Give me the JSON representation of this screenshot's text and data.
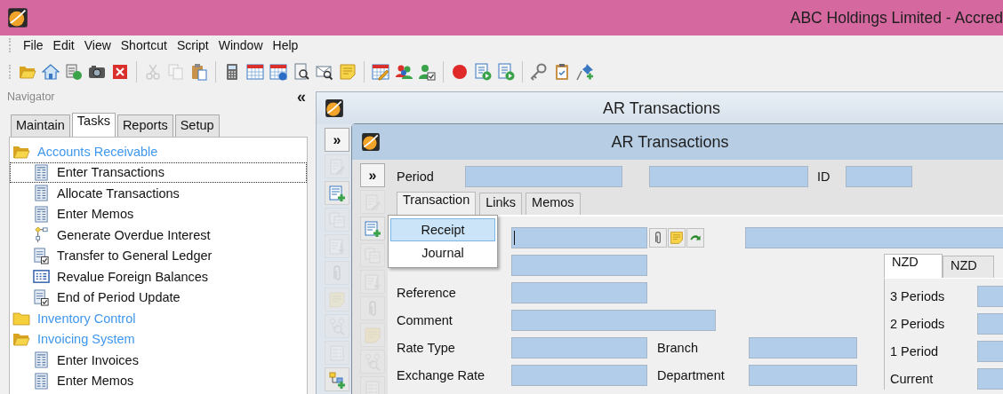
{
  "window": {
    "title": "ABC Holdings Limited - Accred"
  },
  "menu_bar": [
    "File",
    "Edit",
    "View",
    "Shortcut",
    "Script",
    "Window",
    "Help"
  ],
  "toolbar": [
    {
      "kind": "folder-open",
      "disabled": false
    },
    {
      "kind": "home",
      "disabled": false
    },
    {
      "kind": "db-refresh",
      "disabled": false
    },
    {
      "kind": "camera",
      "disabled": false
    },
    {
      "kind": "close",
      "disabled": false
    },
    {
      "kind": "separator"
    },
    {
      "kind": "scissors",
      "disabled": true
    },
    {
      "kind": "copy",
      "disabled": true
    },
    {
      "kind": "paste",
      "disabled": false
    },
    {
      "kind": "separator"
    },
    {
      "kind": "calculator",
      "disabled": false
    },
    {
      "kind": "calendar",
      "disabled": false
    },
    {
      "kind": "calendar-info",
      "disabled": false
    },
    {
      "kind": "scroll-search",
      "disabled": false
    },
    {
      "kind": "mail-search",
      "disabled": false
    },
    {
      "kind": "note",
      "disabled": false
    },
    {
      "kind": "separator"
    },
    {
      "kind": "calendar-edit",
      "disabled": false
    },
    {
      "kind": "users",
      "disabled": false
    },
    {
      "kind": "user-check",
      "disabled": false
    },
    {
      "kind": "separator"
    },
    {
      "kind": "record",
      "disabled": false
    },
    {
      "kind": "script-play",
      "disabled": false
    },
    {
      "kind": "doc-play",
      "disabled": false
    },
    {
      "kind": "separator"
    },
    {
      "kind": "key",
      "disabled": false
    },
    {
      "kind": "clipboard",
      "disabled": false
    },
    {
      "kind": "pin-add",
      "disabled": false
    }
  ],
  "navigator": {
    "title": "Navigator",
    "collapse": "«",
    "tabs": [
      {
        "label": "Maintain",
        "selected": false
      },
      {
        "label": "Tasks",
        "selected": true
      },
      {
        "label": "Reports",
        "selected": false
      },
      {
        "label": "Setup",
        "selected": false
      }
    ],
    "tree": [
      {
        "label": "Accounts Receivable",
        "kind": "folder",
        "expanded": true,
        "children": [
          {
            "label": "Enter Transactions",
            "kind": "grid-doc",
            "focused": true
          },
          {
            "label": "Allocate Transactions",
            "kind": "grid-doc",
            "focused": false
          },
          {
            "label": "Enter Memos",
            "kind": "grid-doc",
            "focused": false
          },
          {
            "label": "Generate Overdue Interest",
            "kind": "flow",
            "focused": false
          },
          {
            "label": "Transfer to General Ledger",
            "kind": "doc-check",
            "focused": false
          },
          {
            "label": "Revalue Foreign Balances",
            "kind": "table",
            "focused": false
          },
          {
            "label": "End of Period Update",
            "kind": "doc-check",
            "focused": false
          }
        ]
      },
      {
        "label": "Inventory Control",
        "kind": "folder",
        "expanded": false
      },
      {
        "label": "Invoicing System",
        "kind": "folder",
        "expanded": true,
        "children": [
          {
            "label": "Enter Invoices",
            "kind": "grid-doc",
            "focused": false
          },
          {
            "label": "Enter Memos",
            "kind": "grid-doc",
            "focused": false
          }
        ]
      }
    ]
  },
  "outer_window": {
    "title": "AR Transactions",
    "expand_button": "»",
    "side_toolbar": [
      {
        "kind": "edit-doc",
        "disabled": true
      },
      {
        "kind": "add-doc",
        "disabled": false
      },
      {
        "kind": "copy-doc",
        "disabled": true
      },
      {
        "kind": "import-doc",
        "disabled": true
      },
      {
        "kind": "paperclip",
        "disabled": true
      },
      {
        "kind": "note",
        "disabled": true
      },
      {
        "kind": "search-tree",
        "disabled": true
      },
      {
        "kind": "list",
        "disabled": true
      },
      {
        "kind": "tree-add",
        "disabled": false
      }
    ]
  },
  "inner_window": {
    "title": "AR Transactions",
    "expand_button": "»",
    "side_toolbar": [
      {
        "kind": "edit-doc",
        "disabled": true
      },
      {
        "kind": "add-doc",
        "disabled": false
      },
      {
        "kind": "copy-doc",
        "disabled": true
      },
      {
        "kind": "import-doc",
        "disabled": true
      },
      {
        "kind": "paperclip",
        "disabled": true
      },
      {
        "kind": "note",
        "disabled": true
      },
      {
        "kind": "search-tree",
        "disabled": true
      },
      {
        "kind": "list",
        "disabled": true
      }
    ],
    "period_label": "Period",
    "id_label": "ID",
    "tabs": [
      {
        "label": "Transaction",
        "selected": true
      },
      {
        "label": "Links",
        "selected": false
      },
      {
        "label": "Memos",
        "selected": false
      }
    ],
    "popup_menu": [
      {
        "label": "Receipt",
        "selected": true
      },
      {
        "label": "Journal",
        "selected": false
      }
    ],
    "rows": [
      {
        "kind": "single",
        "label": "Reference"
      },
      {
        "kind": "wide",
        "label": "Comment"
      },
      {
        "kind": "pair",
        "label": "Rate Type",
        "second_label": "Branch"
      },
      {
        "kind": "pair",
        "label": "Exchange Rate",
        "second_label": "Department"
      }
    ],
    "currency_tabs": [
      {
        "label": "NZD",
        "selected": true
      },
      {
        "label": "NZD",
        "selected": false
      }
    ],
    "ageing_rows": [
      "3 Periods",
      "2 Periods",
      "1 Period",
      "Current"
    ]
  }
}
